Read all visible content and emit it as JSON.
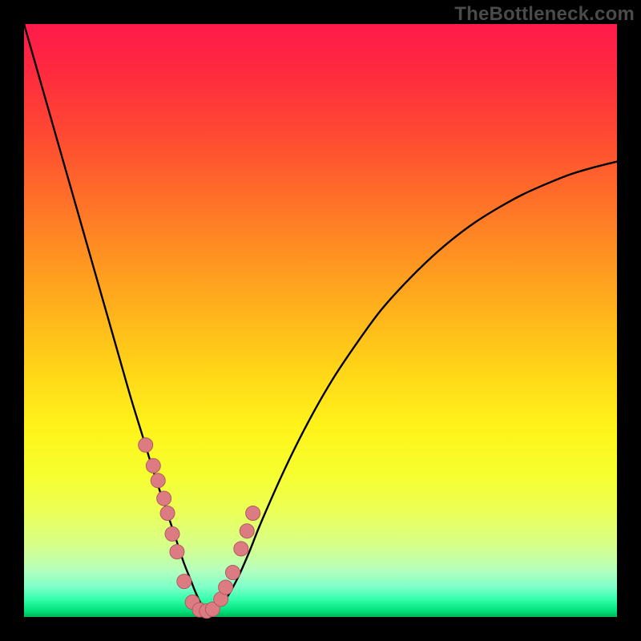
{
  "watermark": {
    "text": "TheBottleneck.com"
  },
  "colors": {
    "curve_stroke": "#000000",
    "marker_fill": "#dd7b82",
    "marker_stroke": "#b25a62"
  },
  "chart_data": {
    "type": "line",
    "title": "",
    "xlabel": "",
    "ylabel": "",
    "xlim": [
      0,
      100
    ],
    "ylim": [
      0,
      100
    ],
    "grid": false,
    "legend": false,
    "series": [
      {
        "name": "bottleneck-curve",
        "x": [
          0,
          2,
          4,
          6,
          8,
          10,
          12,
          14,
          16,
          18,
          20,
          22,
          24,
          26,
          27,
          28,
          29,
          30,
          31,
          32,
          34,
          36,
          38,
          40,
          44,
          48,
          52,
          56,
          60,
          64,
          68,
          72,
          76,
          80,
          84,
          88,
          92,
          96,
          100
        ],
        "y": [
          100,
          93,
          86,
          79,
          72,
          65,
          58,
          51,
          44,
          37,
          30.5,
          24,
          18,
          12,
          9,
          6.5,
          4,
          2,
          1,
          1.2,
          3,
          6.5,
          11,
          16,
          25,
          33,
          40,
          46,
          51.5,
          56,
          60,
          63.5,
          66.5,
          69,
          71.2,
          73,
          74.6,
          75.8,
          76.8
        ]
      }
    ],
    "markers": {
      "name": "highlight-points",
      "x": [
        20.5,
        21.8,
        22.6,
        23.6,
        24.2,
        25.0,
        25.8,
        27.0,
        28.4,
        29.6,
        30.8,
        31.8,
        33.2,
        34.0,
        35.2,
        36.6,
        37.6,
        38.6
      ],
      "y": [
        29.0,
        25.5,
        23.0,
        20.0,
        17.5,
        14.0,
        11.0,
        6.0,
        2.5,
        1.2,
        1.0,
        1.3,
        3.0,
        5.0,
        7.5,
        11.5,
        14.5,
        17.5
      ]
    }
  }
}
